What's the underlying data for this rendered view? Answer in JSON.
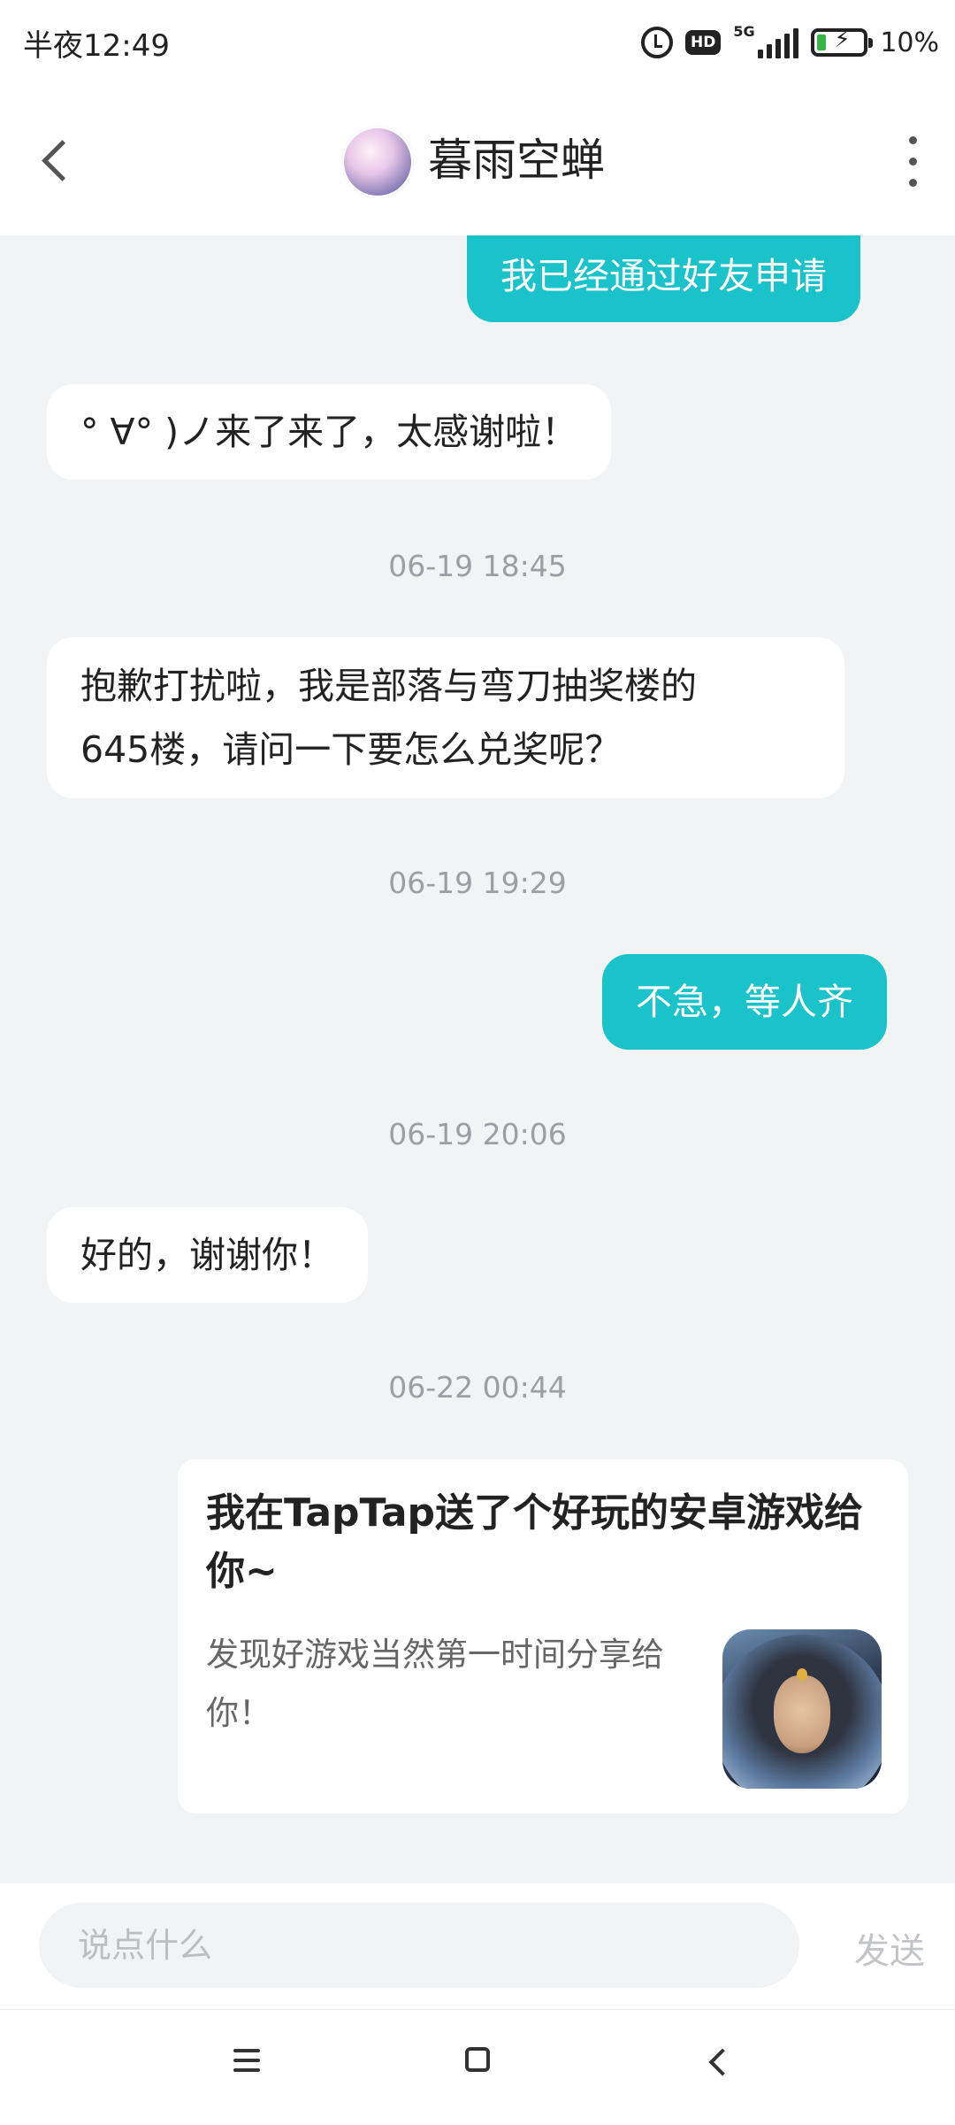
{
  "status_bar": {
    "time": "半夜12:49",
    "network": "5G",
    "hd_badge": "HD",
    "battery": "10%",
    "icons": [
      "alarm-icon",
      "hd-icon",
      "signal-icon",
      "battery-charging-icon"
    ]
  },
  "header": {
    "title": "暮雨空蝉",
    "back_icon": "chevron-left-icon",
    "more_icon": "more-vertical-icon"
  },
  "messages": [
    {
      "side": "right",
      "text": "我已经通过好友申请"
    },
    {
      "side": "left",
      "text": "°  ∀° )ノ来了来了，太感谢啦！"
    },
    {
      "type": "time",
      "text": "06-19 18:45"
    },
    {
      "side": "left",
      "lines": [
        "抱歉打扰啦，我是部落与弯刀抽奖楼的",
        "645楼，请问一下要怎么兑奖呢？"
      ]
    },
    {
      "type": "time",
      "text": "06-19 19:29"
    },
    {
      "side": "right",
      "text": "不急，等人齐"
    },
    {
      "type": "time",
      "text": "06-19 20:06"
    },
    {
      "side": "left",
      "text": "好的，谢谢你！"
    },
    {
      "type": "time",
      "text": "06-22 00:44"
    }
  ],
  "share_card": {
    "title": "我在TapTap送了个好玩的安卓游戏给你~",
    "description": "发现好游戏当然第一时间分享给你！"
  },
  "input": {
    "placeholder": "说点什么",
    "value": "",
    "send_label": "发送"
  },
  "navbar": {
    "icons": [
      "menu-icon",
      "home-icon",
      "back-icon"
    ]
  },
  "colors": {
    "accent": "#19c3c9",
    "background": "#f2f3f5",
    "timestamp": "#9c9ea3"
  }
}
